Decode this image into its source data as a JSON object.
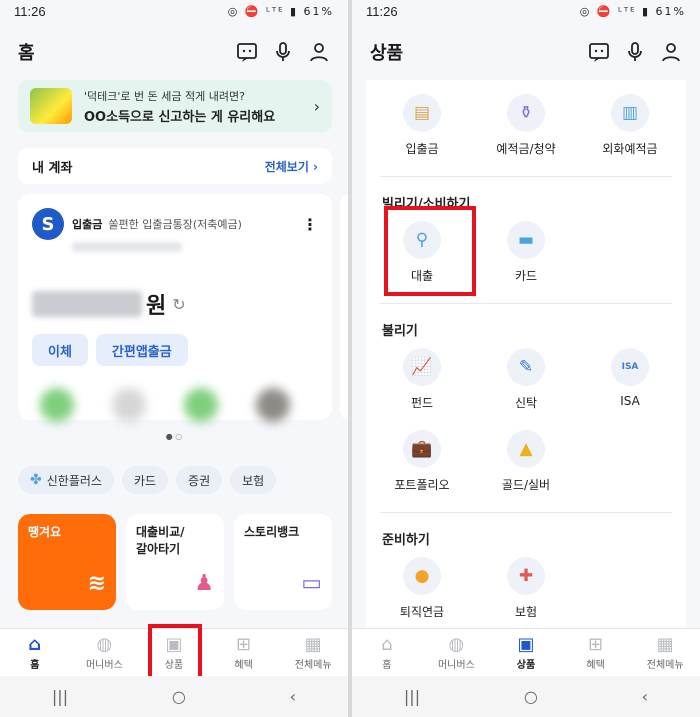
{
  "status": {
    "time": "11:26",
    "icons": "◎ ⛔ ᴸᵀᴱ ▮ 61%"
  },
  "left": {
    "header_title": "홈",
    "promo": {
      "line1": "'덕테크'로 번 돈 세금 적게 내려면?",
      "line2": "OO소득으로 신고하는 게 유리해요"
    },
    "account_section": {
      "title": "내 계좌",
      "more": "전체보기 ›"
    },
    "account": {
      "type": "입출금",
      "name": "쏠편한 입출금통장(저축예금)",
      "currency_unit": "원"
    },
    "account_buttons": [
      "이체",
      "간편앱출금"
    ],
    "chips": [
      "신한플러스",
      "카드",
      "증권",
      "보험"
    ],
    "tiles": [
      "땡겨요",
      "대출비교/\n갈아타기",
      "스토리뱅크"
    ]
  },
  "right": {
    "header_title": "상품",
    "top_items": [
      "입출금",
      "예적금/청약",
      "외화예적금"
    ],
    "section_borrow": "빌리기/소비하기",
    "borrow_items": [
      "대출",
      "카드"
    ],
    "section_grow": "불리기",
    "grow_items": [
      "펀드",
      "신탁",
      "ISA",
      "포트폴리오",
      "골드/실버"
    ],
    "section_prepare": "준비하기",
    "prepare_items": [
      "퇴직연금",
      "보험"
    ]
  },
  "nav": [
    "홈",
    "머니버스",
    "상품",
    "혜택",
    "전체메뉴"
  ],
  "colors": {
    "accent": "#1e56d4",
    "highlight": "#e8111d",
    "orange": "#ff6d0a"
  }
}
